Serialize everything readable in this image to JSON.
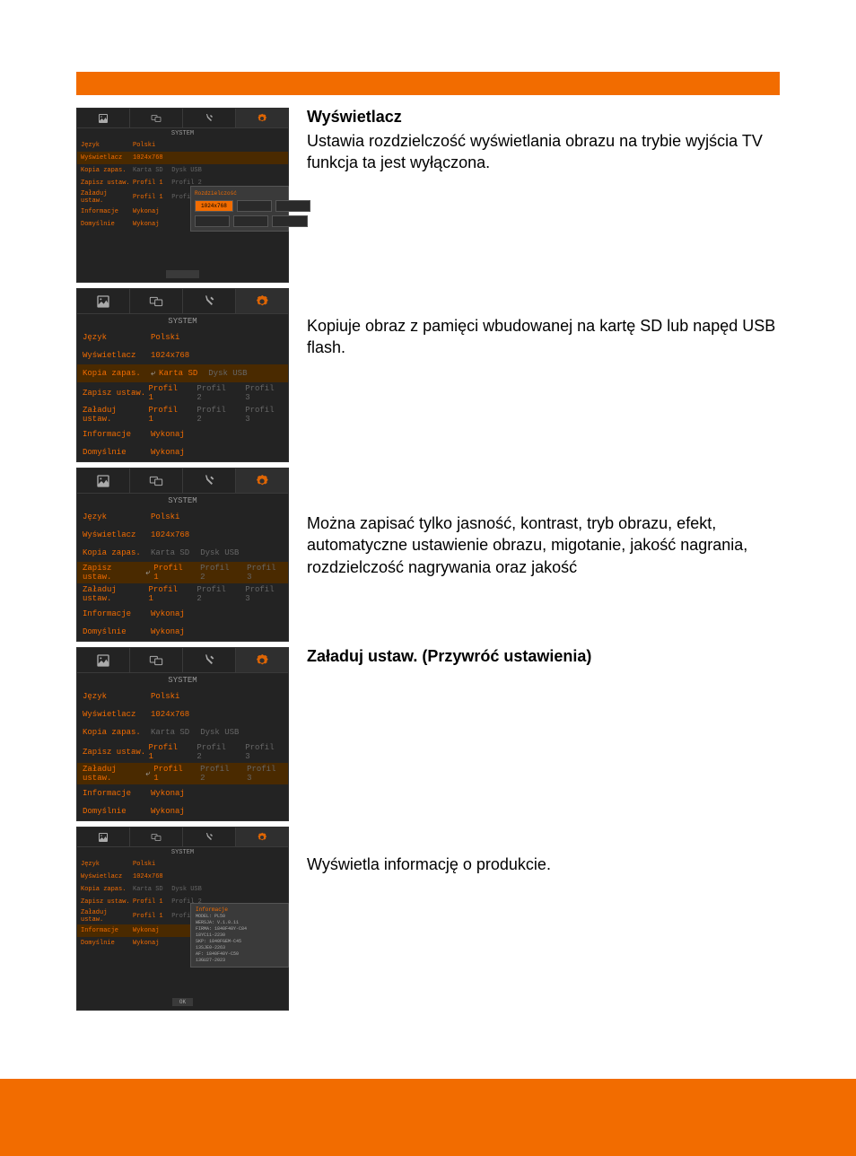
{
  "header": {
    "present": true
  },
  "tabs": {
    "image_icon": "image-icon",
    "dual_icon": "dual-screen-icon",
    "tools_icon": "tools-icon",
    "gear_icon": "gear-icon"
  },
  "system_title": "SYSTEM",
  "menu": {
    "jezyk": {
      "label": "Język",
      "value": "Polski"
    },
    "wyswietlacz": {
      "label": "Wyświetlacz",
      "value": "1024x768"
    },
    "kopia": {
      "label": "Kopia zapas.",
      "val1": "Karta SD",
      "val2": "Dysk USB"
    },
    "zapisz": {
      "label": "Zapisz ustaw.",
      "val1": "Profil 1",
      "val2": "Profil 2",
      "val3": "Profil 3"
    },
    "zaladuj": {
      "label": "Załaduj ustaw.",
      "val1": "Profil 1",
      "val2": "Profil 2",
      "val3": "Profil 3"
    },
    "informacje": {
      "label": "Informacje",
      "value": "Wykonaj"
    },
    "domyslnie": {
      "label": "Domyślnie",
      "value": "Wykonaj"
    }
  },
  "popup1": {
    "title": "Rozdzielczość",
    "options": [
      "1024x768",
      "",
      "",
      "",
      "",
      ""
    ]
  },
  "info_popup": {
    "title": "Informacje",
    "rows": [
      "MODEL:   PL50",
      "WERSJA:  V.1.0.11",
      "FIRMA:   1840F40Y-C84",
      "         18YC11-2230",
      "SKP:     1840FGEM-C45",
      "         13SJE0-2263",
      "AF:      1840F40Y-C50",
      "         13GU27-2023"
    ]
  },
  "bottom_ok": "OK",
  "section1": {
    "title": "Wyświetlacz",
    "desc": "Ustawia rozdzielczość wyświetlania obrazu na trybie wyjścia TV funkcja ta jest wyłączona."
  },
  "section2": {
    "desc": "Kopiuje obraz z pamięci wbudowanej na kartę SD lub napęd USB flash."
  },
  "section3": {
    "desc": "Można zapisać tylko jasność, kontrast, tryb obrazu, efekt, automatyczne ustawienie obrazu, migotanie, jakość nagrania, rozdzielczość nagrywania oraz jakość"
  },
  "section4": {
    "title": "Załaduj ustaw. (Przywróć ustawienia)"
  },
  "section5": {
    "desc": "Wyświetla informację o produkcie."
  }
}
